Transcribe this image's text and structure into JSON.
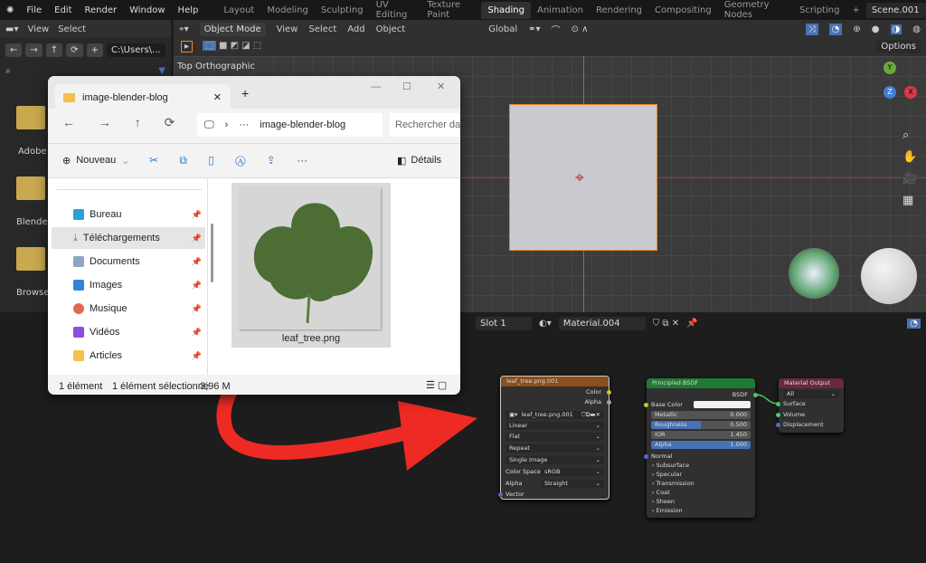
{
  "menu": {
    "items": [
      "File",
      "Edit",
      "Render",
      "Window",
      "Help"
    ]
  },
  "workspaces": [
    "Layout",
    "Modeling",
    "Sculpting",
    "UV Editing",
    "Texture Paint",
    "Shading",
    "Animation",
    "Rendering",
    "Compositing",
    "Geometry Nodes",
    "Scripting",
    "+"
  ],
  "active_workspace": "Shading",
  "scene": "Scene.001",
  "filebrowser": {
    "view": "View",
    "select": "Select",
    "path": "C:\\Users\\...",
    "folders": [
      "Adobe",
      "Blender",
      "Browser"
    ]
  },
  "viewport": {
    "mode": "Object Mode",
    "menus": [
      "View",
      "Select",
      "Add",
      "Object"
    ],
    "orientation": "Global",
    "view_label": "Top Orthographic",
    "options": "Options",
    "gizmo": {
      "x": "X",
      "y": "Y",
      "z": "Z"
    }
  },
  "node_editor": {
    "slot": "Slot 1",
    "material": "Material.004"
  },
  "explorer": {
    "tab_title": "image-blender-blog",
    "address": "image-blender-blog",
    "search_placeholder": "Rechercher da",
    "new": "Nouveau",
    "details": "Détails",
    "nav": [
      {
        "label": "Bureau",
        "color": "#2a9fd8"
      },
      {
        "label": "Téléchargements",
        "color": "#1aa37a"
      },
      {
        "label": "Documents",
        "color": "#8fa5c4"
      },
      {
        "label": "Images",
        "color": "#2f86d6"
      },
      {
        "label": "Musique",
        "color": "#e06a50"
      },
      {
        "label": "Vidéos",
        "color": "#8a4ee0"
      },
      {
        "label": "Articles",
        "color": "#f2c14e"
      }
    ],
    "file": "leaf_tree.png",
    "status_count": "1 élément",
    "status_selected": "1 élément sélectionné",
    "status_size": "3,96 M"
  },
  "nodes": {
    "image": {
      "title": "leaf_tree.png.001",
      "out_color": "Color",
      "out_alpha": "Alpha",
      "image": "leaf_tree.png.001",
      "interp": "Linear",
      "proj": "Flat",
      "ext": "Repeat",
      "source": "Single Image",
      "cs_label": "Color Space",
      "cs": "sRGB",
      "alpha_label": "Alpha",
      "alpha": "Straight",
      "vector": "Vector"
    },
    "bsdf": {
      "title": "Principled BSDF",
      "out": "BSDF",
      "base_color": "Base Color",
      "metallic": "Metallic",
      "metallic_v": "0.000",
      "roughness": "Roughness",
      "roughness_v": "0.500",
      "ior": "IOR",
      "ior_v": "1.450",
      "alpha": "Alpha",
      "alpha_v": "1.000",
      "normal": "Normal",
      "panels": [
        "Subsurface",
        "Specular",
        "Transmission",
        "Coat",
        "Sheen",
        "Emission"
      ]
    },
    "output": {
      "title": "Material Output",
      "target": "All",
      "surface": "Surface",
      "volume": "Volume",
      "displacement": "Displacement"
    }
  },
  "colors": {
    "accent": "#4772b3",
    "selection": "#e8892b",
    "arrow": "#ee2a24"
  }
}
